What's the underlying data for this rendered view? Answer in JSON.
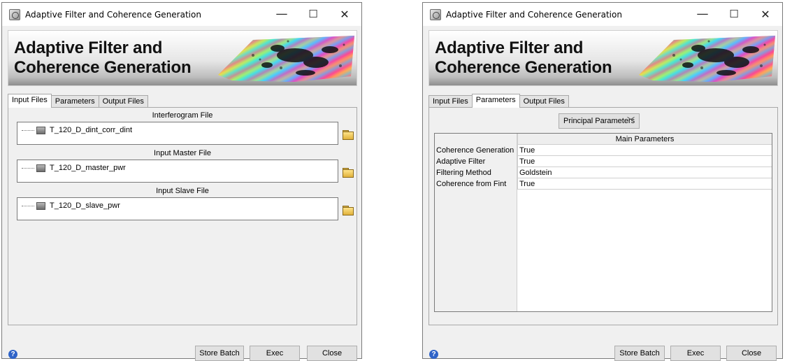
{
  "window_title": "Adaptive Filter and Coherence Generation",
  "banner_title_line1": "Adaptive Filter and",
  "banner_title_line2": "Coherence Generation",
  "controls": {
    "minimize": "—",
    "maximize": "☐",
    "close": "✕"
  },
  "tabs": [
    {
      "label": "Input Files"
    },
    {
      "label": "Parameters"
    },
    {
      "label": "Output Files"
    }
  ],
  "left": {
    "active_tab": "Input Files",
    "sections": [
      {
        "label": "Interferogram File",
        "file": "T_120_D_dint_corr_dint"
      },
      {
        "label": "Input Master File",
        "file": "T_120_D_master_pwr"
      },
      {
        "label": "Input Slave File",
        "file": "T_120_D_slave_pwr"
      }
    ]
  },
  "right": {
    "active_tab": "Parameters",
    "dropdown": "Principal Parameters",
    "table_header": "Main Parameters",
    "rows": [
      {
        "name": "Coherence Generation",
        "value": "True"
      },
      {
        "name": "Adaptive Filter",
        "value": "True"
      },
      {
        "name": "Filtering Method",
        "value": "Goldstein"
      },
      {
        "name": "Coherence from Fint",
        "value": "True"
      }
    ]
  },
  "buttons": {
    "store_batch": "Store Batch",
    "exec": "Exec",
    "close": "Close"
  },
  "help_icon_glyph": "?",
  "icons": [
    "app-icon",
    "minimize-icon",
    "maximize-icon",
    "close-icon",
    "file-icon",
    "folder-icon",
    "chevron-down-icon",
    "help-icon"
  ]
}
